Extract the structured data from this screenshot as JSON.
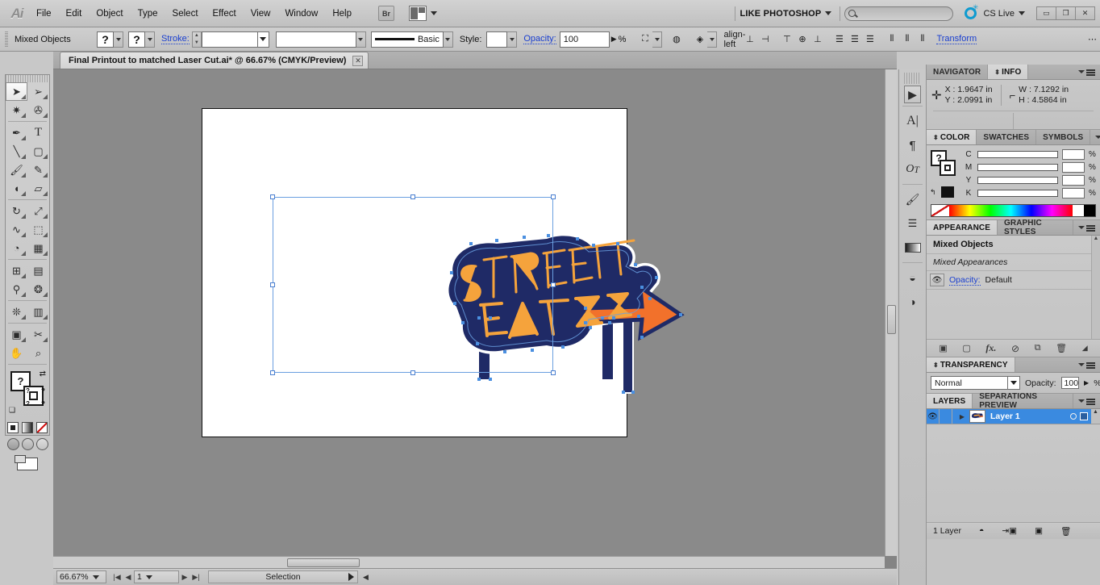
{
  "app": {
    "name": "Adobe Illustrator",
    "logo": "Ai"
  },
  "menubar": {
    "items": [
      "File",
      "Edit",
      "Object",
      "Type",
      "Select",
      "Effect",
      "View",
      "Window",
      "Help"
    ],
    "bridge_label": "Br",
    "workspace": "LIKE PHOTOSHOP",
    "search_placeholder": "",
    "cslive_label": "CS Live",
    "window_buttons": [
      "minimize",
      "restore",
      "close"
    ]
  },
  "controlbar": {
    "selection_label": "Mixed Objects",
    "fill_swatch": "?",
    "stroke_swatch": "?",
    "stroke_label": "Stroke:",
    "stroke_weight": "",
    "stroke_profile": "Basic",
    "style_label": "Style:",
    "style_value": "",
    "opacity_label": "Opacity:",
    "opacity_value": "100",
    "percent": "%",
    "transform_label": "Transform",
    "align_icons": [
      "align-left",
      "align-center-horizontal",
      "align-right",
      "align-top",
      "align-middle-vertical",
      "align-bottom",
      "distribute-top",
      "distribute-center",
      "distribute-bottom",
      "distribute-left",
      "distribute-center-h",
      "distribute-right"
    ]
  },
  "document": {
    "tab_title": "Final Printout to matched Laser Cut.ai* @ 66.67% (CMYK/Preview)",
    "close_glyph": "✕"
  },
  "toolbox": {
    "tools": [
      {
        "name": "selection-tool",
        "glyph": "➤",
        "selected": true
      },
      {
        "name": "direct-selection-tool",
        "glyph": "➤",
        "selected": false
      },
      {
        "name": "magic-wand-tool",
        "glyph": "✷",
        "selected": false
      },
      {
        "name": "lasso-tool",
        "glyph": "✇",
        "selected": false
      },
      {
        "name": "pen-tool",
        "glyph": "✒",
        "selected": false
      },
      {
        "name": "type-tool",
        "glyph": "T",
        "selected": false
      },
      {
        "name": "line-segment-tool",
        "glyph": "╲",
        "selected": false
      },
      {
        "name": "rectangle-tool",
        "glyph": "▭",
        "selected": false
      },
      {
        "name": "paintbrush-tool",
        "glyph": "🖌",
        "selected": false
      },
      {
        "name": "pencil-tool",
        "glyph": "✎",
        "selected": false
      },
      {
        "name": "blob-brush-tool",
        "glyph": "◗",
        "selected": false
      },
      {
        "name": "eraser-tool",
        "glyph": "▱",
        "selected": false
      },
      {
        "name": "rotate-tool",
        "glyph": "↻",
        "selected": false
      },
      {
        "name": "scale-tool",
        "glyph": "⤢",
        "selected": false
      },
      {
        "name": "width-tool",
        "glyph": "∿",
        "selected": false
      },
      {
        "name": "free-transform-tool",
        "glyph": "⬚",
        "selected": false
      },
      {
        "name": "shape-builder-tool",
        "glyph": "◉",
        "selected": false
      },
      {
        "name": "perspective-grid-tool",
        "glyph": "▦",
        "selected": false
      },
      {
        "name": "mesh-tool",
        "glyph": "⊞",
        "selected": false
      },
      {
        "name": "gradient-tool",
        "glyph": "▤",
        "selected": false
      },
      {
        "name": "eyedropper-tool",
        "glyph": "⚲",
        "selected": false
      },
      {
        "name": "blend-tool",
        "glyph": "❂",
        "selected": false
      },
      {
        "name": "symbol-sprayer-tool",
        "glyph": "❊",
        "selected": false
      },
      {
        "name": "column-graph-tool",
        "glyph": "▥",
        "selected": false
      },
      {
        "name": "artboard-tool",
        "glyph": "▣",
        "selected": false
      },
      {
        "name": "slice-tool",
        "glyph": "✂",
        "selected": false
      },
      {
        "name": "hand-tool",
        "glyph": "✋",
        "selected": false
      },
      {
        "name": "zoom-tool",
        "glyph": "🔍",
        "selected": false
      }
    ],
    "fill_value": "?",
    "stroke_value": "?",
    "color_modes": [
      "color",
      "gradient",
      "none"
    ],
    "draw_modes": [
      "draw-normal",
      "draw-behind",
      "draw-inside"
    ],
    "screen_mode": "change-screen-mode"
  },
  "canvas": {
    "artwork_title": "STREET EATZZ",
    "word_top": "STREET",
    "word_bottom": "EATZZ",
    "colors": {
      "orange": "#F5A33C",
      "orange_arrow": "#F2712B",
      "navy": "#1F2A66",
      "selection_blue": "#4A8FE0",
      "anchor_blue": "#3F7FD4",
      "artboard_white": "#FFFFFF",
      "canvas_gray": "#8A8A8A"
    }
  },
  "statusbar": {
    "zoom": "66.67%",
    "page_number": "1",
    "status_text": "Selection",
    "nav_first": "|◀",
    "nav_prev": "◀",
    "nav_next": "▶",
    "nav_last": "▶|"
  },
  "iconstrip": {
    "icons": [
      "play-icon",
      "character-icon",
      "paragraph-icon",
      "opentype-icon",
      "brushes-icon",
      "stroke-icon",
      "gradient-icon",
      "pathfinder-icon",
      "transparency-icon"
    ],
    "glyphs": [
      "▶",
      "A",
      "¶",
      "Oᴛ",
      "🖌",
      "≡",
      "▤",
      "◒",
      "◑"
    ]
  },
  "panels": {
    "navigator_info": {
      "tabs": [
        "NAVIGATOR",
        "INFO"
      ],
      "active_tab": "INFO",
      "x_label": "X :",
      "x_value": "1.9647 in",
      "y_label": "Y :",
      "y_value": "2.0991 in",
      "w_label": "W :",
      "w_value": "7.1292 in",
      "h_label": "H :",
      "h_value": "4.5864 in"
    },
    "color": {
      "tabs": [
        "COLOR",
        "SWATCHES",
        "SYMBOLS"
      ],
      "active_tab": "COLOR",
      "fill_swatch": "?",
      "channels": [
        {
          "label": "C",
          "value": ""
        },
        {
          "label": "M",
          "value": ""
        },
        {
          "label": "Y",
          "value": ""
        },
        {
          "label": "K",
          "value": ""
        }
      ],
      "percent": "%"
    },
    "appearance": {
      "tabs": [
        "APPEARANCE",
        "GRAPHIC STYLES"
      ],
      "active_tab": "APPEARANCE",
      "object_title": "Mixed Objects",
      "subtitle": "Mixed Appearances",
      "opacity_label": "Opacity:",
      "opacity_value": "Default",
      "footer_icons": [
        "add-new-stroke",
        "add-new-fill",
        "add-new-effect",
        "clear-appearance",
        "duplicate-item",
        "delete-item"
      ],
      "footer_glyphs": [
        "▣",
        "▢",
        "fx.",
        "⊘",
        "⧉",
        "🗑"
      ]
    },
    "transparency": {
      "title": "TRANSPARENCY",
      "blend_mode": "Normal",
      "opacity_label": "Opacity:",
      "opacity_value": "100",
      "percent": "%"
    },
    "layers": {
      "tabs": [
        "LAYERS",
        "SEPARATIONS PREVIEW"
      ],
      "active_tab": "LAYERS",
      "rows": [
        {
          "name": "Layer 1",
          "visible": true,
          "locked": false,
          "selected": true
        }
      ],
      "footer_text": "1 Layer",
      "footer_icons": [
        "make-clipping-mask",
        "create-new-sublayer",
        "create-new-layer",
        "delete-selection"
      ],
      "footer_glyphs": [
        "◓",
        "⇥▣",
        "▣",
        "🗑"
      ]
    }
  }
}
